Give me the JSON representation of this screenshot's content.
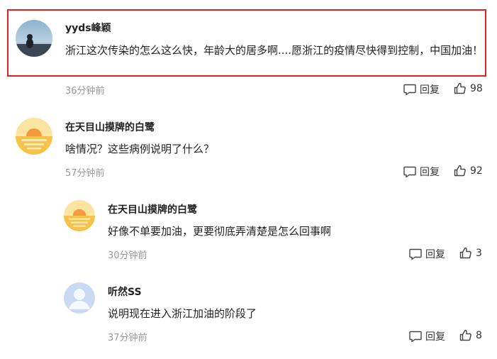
{
  "comments": [
    {
      "user": "yyds峰颖",
      "text": "浙江这次传染的怎么这么快，年龄大的居多啊....愿浙江的疫情尽快得到控制，中国加油！",
      "time": "36分钟前",
      "reply_label": "回复",
      "likes": "98",
      "avatar": "photo"
    },
    {
      "user": "在天目山摸牌的白鹭",
      "text": "啥情况？这些病例说明了什么？",
      "time": "57分钟前",
      "reply_label": "回复",
      "likes": "92",
      "avatar": "sunset"
    }
  ],
  "replies": [
    {
      "user": "在天目山摸牌的白鹭",
      "text": "好像不单要加油，更要彻底弄清楚是怎么回事啊",
      "time": "30分钟前",
      "reply_label": "回复",
      "likes": "3",
      "avatar": "sunset"
    },
    {
      "user": "听然SS",
      "text": "说明现在进入浙江加油的阶段了",
      "time": "37分钟前",
      "reply_label": "回复",
      "likes": "8",
      "avatar": "default-user"
    }
  ],
  "colors": {
    "highlight": "#e02020",
    "meta": "#999999"
  }
}
